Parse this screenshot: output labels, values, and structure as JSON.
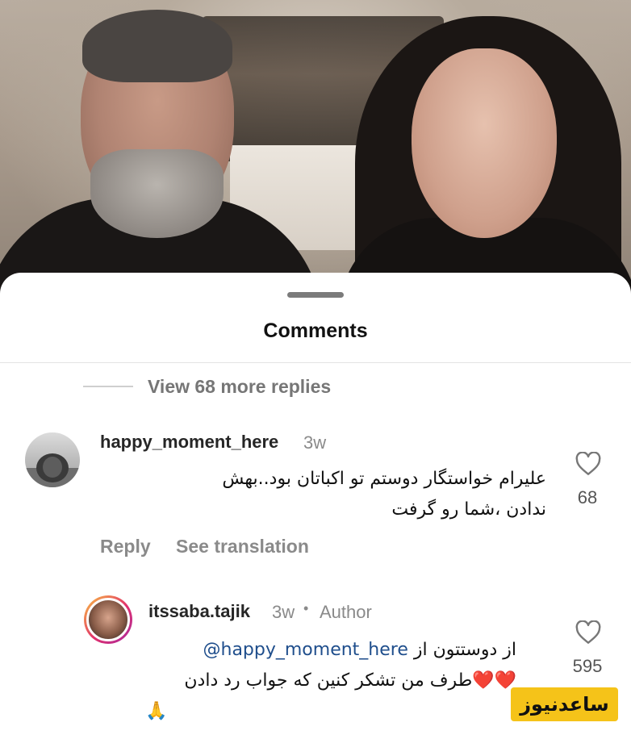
{
  "sheet": {
    "title": "Comments",
    "view_more": "View 68 more replies"
  },
  "comment": {
    "username": "happy_moment_here",
    "time": "3w",
    "text_line1": "علیرام خواستگار دوستم تو اکباتان بود..بهش",
    "text_line2": "ندادن ،شما رو گرفت",
    "likes": "68",
    "reply_label": "Reply",
    "translate_label": "See translation"
  },
  "reply": {
    "username": "itssaba.tajik",
    "time": "3w",
    "separator": "•",
    "author_badge": "Author",
    "mention": "@happy_moment_here",
    "text_line1_suffix": "از دوستتون از",
    "text_line2": "❤️❤️طرف من تشکر کنین که جواب رد دادن",
    "text_line3": "🙏",
    "likes": "595"
  },
  "watermark": "ساعدنیوز",
  "colors": {
    "mention": "#1f4e8c",
    "watermark_bg": "#f5c319",
    "muted": "#8a8a8a"
  },
  "icons": [
    "heart-outline-icon",
    "drag-handle"
  ]
}
